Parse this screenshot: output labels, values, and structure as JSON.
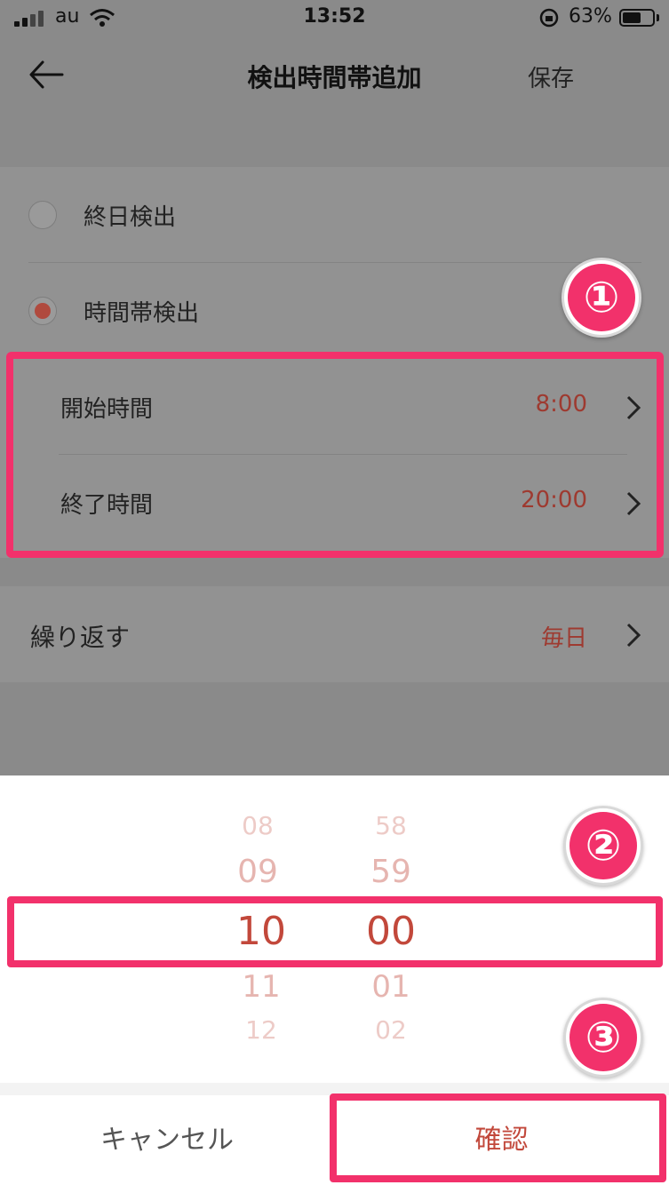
{
  "status_bar": {
    "carrier": "au",
    "time": "13:52",
    "battery": "63%",
    "battery_level": 0.63
  },
  "nav": {
    "title": "検出時間帯追加",
    "save": "保存"
  },
  "mode": {
    "all_day": "終日検出",
    "time_range": "時間帯検出",
    "selected": "time_range"
  },
  "times": {
    "start_label": "開始時間",
    "start_value": "8:00",
    "end_label": "終了時間",
    "end_value": "20:00"
  },
  "repeat": {
    "label": "繰り返す",
    "value": "毎日"
  },
  "picker": {
    "hours": [
      "08",
      "09",
      "10",
      "11",
      "12"
    ],
    "minutes": [
      "58",
      "59",
      "00",
      "01",
      "02"
    ],
    "selected_hour": "10",
    "selected_minute": "00"
  },
  "sheet_buttons": {
    "cancel": "キャンセル",
    "confirm": "確認"
  },
  "badges": [
    "①",
    "②",
    "③"
  ],
  "colors": {
    "accent": "#c2483b",
    "highlight": "#f2316b"
  }
}
